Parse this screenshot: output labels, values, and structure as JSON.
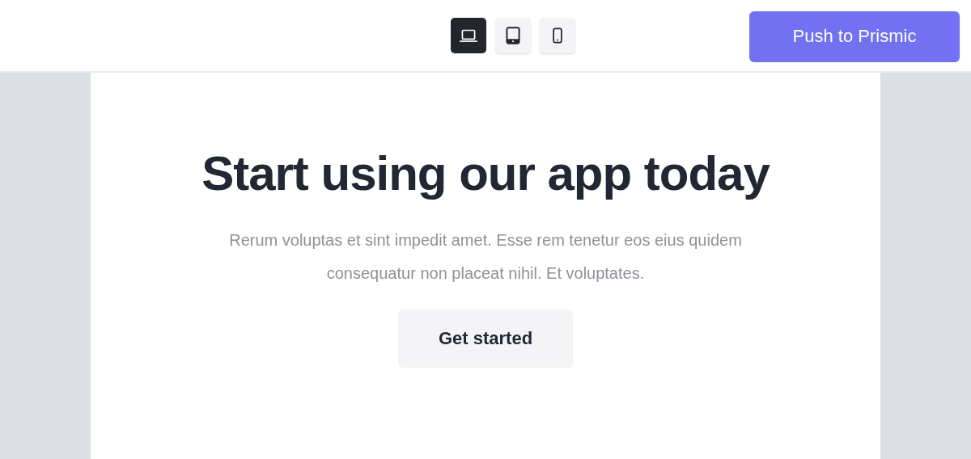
{
  "devices": [
    {
      "kind": "desktop",
      "selected": true
    },
    {
      "kind": "tablet",
      "selected": false
    },
    {
      "kind": "mobile",
      "selected": false
    }
  ],
  "push_button": "Push to Prismic",
  "hero": {
    "title": "Start using our app today",
    "description": "Rerum voluptas et sint impedit amet. Esse rem tenetur eos eius quidem consequatur non placeat nihil. Et voluptates.",
    "button": "Get started"
  }
}
